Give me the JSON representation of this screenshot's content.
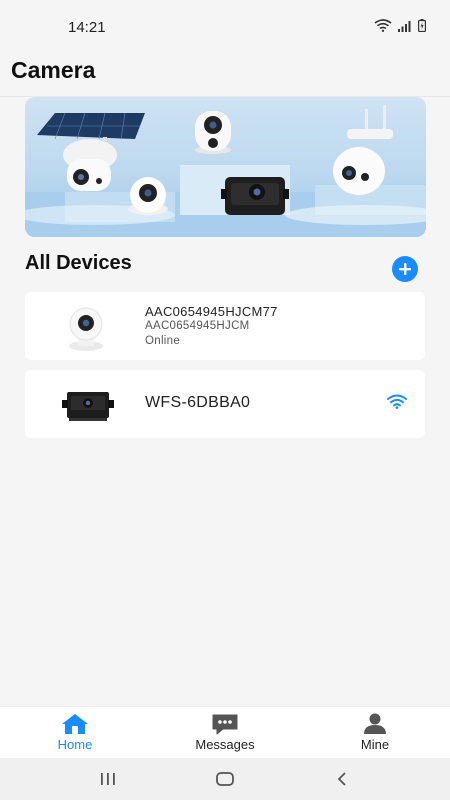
{
  "status": {
    "time": "14:21"
  },
  "header": {
    "title": "Camera"
  },
  "section": {
    "title": "All Devices"
  },
  "devices": [
    {
      "name": "AAC0654945HJCM77",
      "id": "AAC0654945HJCM",
      "status": "Online"
    },
    {
      "name": "WFS-6DBBA0"
    }
  ],
  "nav": {
    "items": [
      {
        "label": "Home",
        "icon": "home-icon",
        "active": true
      },
      {
        "label": "Messages",
        "icon": "chat-icon",
        "active": false
      },
      {
        "label": "Mine",
        "icon": "person-icon",
        "active": false
      }
    ]
  },
  "colors": {
    "accent": "#1a8cff",
    "background": "#f5f5f5",
    "card": "#ffffff"
  }
}
